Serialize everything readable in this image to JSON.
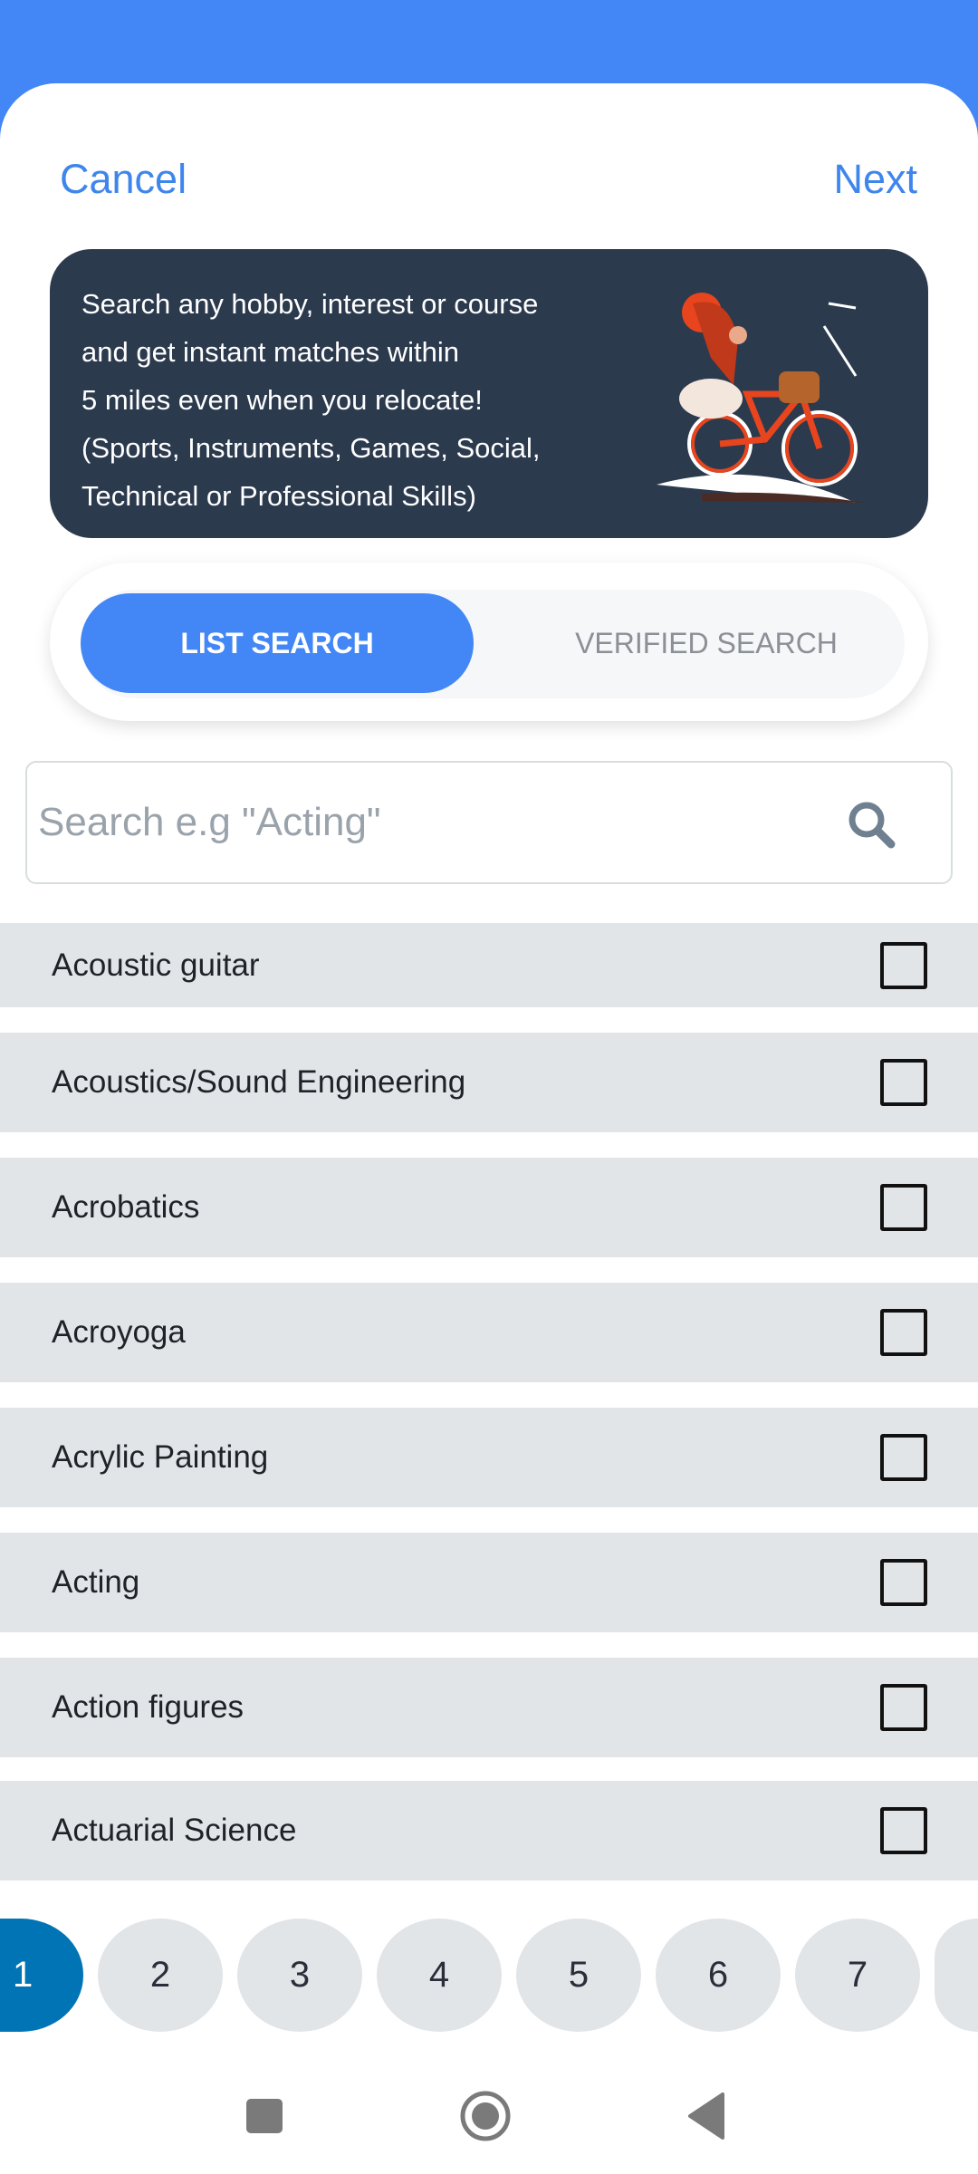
{
  "header": {
    "cancel": "Cancel",
    "next": "Next"
  },
  "banner": {
    "lines": [
      "Search any hobby, interest or course",
      "and get instant matches within",
      "5 miles even when you relocate!",
      "(Sports, Instruments, Games, Social,",
      "Technical or Professional Skills)"
    ]
  },
  "toggle": {
    "active": "LIST SEARCH",
    "inactive": "VERIFIED SEARCH"
  },
  "search": {
    "placeholder": "Search e.g \"Acting\"",
    "value": ""
  },
  "list": [
    {
      "label": "Acoustic guitar",
      "checked": false
    },
    {
      "label": "Acoustics/Sound Engineering",
      "checked": false
    },
    {
      "label": "Acrobatics",
      "checked": false
    },
    {
      "label": "Acroyoga",
      "checked": false
    },
    {
      "label": "Acrylic Painting",
      "checked": false
    },
    {
      "label": "Acting",
      "checked": false
    },
    {
      "label": "Action figures",
      "checked": false
    },
    {
      "label": "Actuarial Science",
      "checked": false
    }
  ],
  "pagination": {
    "pages": [
      "1",
      "2",
      "3",
      "4",
      "5",
      "6",
      "7",
      ""
    ],
    "current": "1"
  },
  "colors": {
    "accent": "#4287f5",
    "banner_bg": "#2c3a4e",
    "page_active": "#0074b5",
    "row_bg": "#e2e5e8"
  },
  "navbar": {
    "icons": [
      "recents-square-icon",
      "home-circle-icon",
      "back-triangle-icon"
    ]
  }
}
